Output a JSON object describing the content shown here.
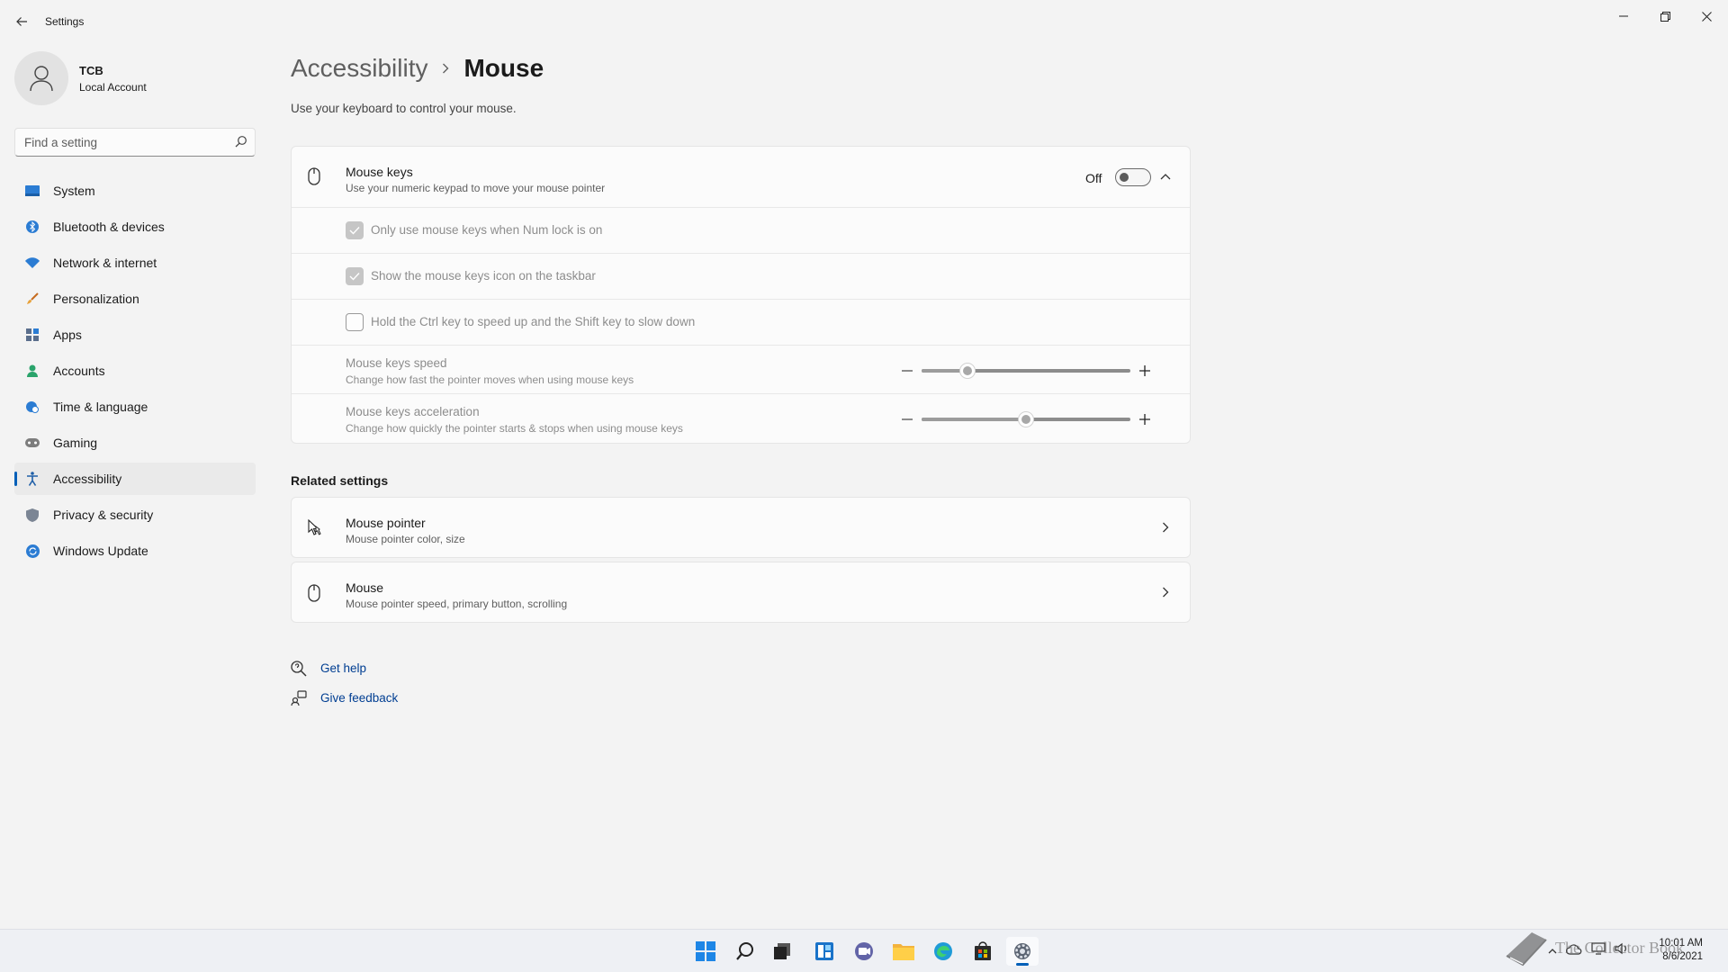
{
  "window": {
    "app_title": "Settings"
  },
  "profile": {
    "name": "TCB",
    "account_type": "Local Account"
  },
  "search": {
    "placeholder": "Find a setting"
  },
  "nav": {
    "items": [
      {
        "label": "System",
        "icon": "monitor-icon"
      },
      {
        "label": "Bluetooth & devices",
        "icon": "bluetooth-icon"
      },
      {
        "label": "Network & internet",
        "icon": "wifi-icon"
      },
      {
        "label": "Personalization",
        "icon": "brush-icon"
      },
      {
        "label": "Apps",
        "icon": "apps-icon"
      },
      {
        "label": "Accounts",
        "icon": "person-icon"
      },
      {
        "label": "Time & language",
        "icon": "globe-clock-icon"
      },
      {
        "label": "Gaming",
        "icon": "gamepad-icon"
      },
      {
        "label": "Accessibility",
        "icon": "accessibility-icon",
        "active": true
      },
      {
        "label": "Privacy & security",
        "icon": "shield-icon"
      },
      {
        "label": "Windows Update",
        "icon": "update-icon"
      }
    ]
  },
  "breadcrumb": {
    "parent": "Accessibility",
    "current": "Mouse"
  },
  "page": {
    "description": "Use your keyboard to control your mouse."
  },
  "mouse_keys": {
    "title": "Mouse keys",
    "subtitle": "Use your numeric keypad to move your mouse pointer",
    "state_label": "Off",
    "enabled": false,
    "options": [
      {
        "label": "Only use mouse keys when Num lock is on",
        "checked": true
      },
      {
        "label": "Show the mouse keys icon on the taskbar",
        "checked": true
      },
      {
        "label": "Hold the Ctrl key to speed up and the Shift key to slow down",
        "checked": false
      }
    ],
    "speed": {
      "title": "Mouse keys speed",
      "subtitle": "Change how fast the pointer moves when using mouse keys",
      "value_fraction": 0.22
    },
    "acceleration": {
      "title": "Mouse keys acceleration",
      "subtitle": "Change how quickly the pointer starts & stops when using mouse keys",
      "value_fraction": 0.5
    }
  },
  "related": {
    "title": "Related settings",
    "items": [
      {
        "title": "Mouse pointer",
        "subtitle": "Mouse pointer color, size",
        "icon": "mouse-pointer-icon"
      },
      {
        "title": "Mouse",
        "subtitle": "Mouse pointer speed, primary button, scrolling",
        "icon": "mouse-icon"
      }
    ]
  },
  "help": {
    "get_help": "Get help",
    "give_feedback": "Give feedback"
  },
  "taskbar": {
    "time": "10:01 AM",
    "date": "8/6/2021"
  },
  "watermark": {
    "text": "The Collector Book"
  },
  "colors": {
    "accent": "#005fb8",
    "link": "#003e92",
    "background": "#f3f3f3"
  }
}
